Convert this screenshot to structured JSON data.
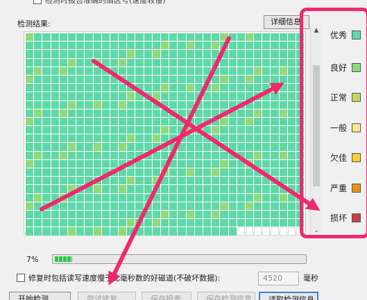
{
  "options": {
    "report_check_label": "检测时报告准确的扇区号(速度较慢)",
    "repair_check_label": "修复时包括读写速度慢于比毫秒数的好磁道(不破坏数据):",
    "threshold_value": "4520",
    "threshold_unit": "毫秒"
  },
  "results": {
    "label": "检测结果:",
    "detail_button": "详细信息",
    "grid": {
      "columns": 33,
      "rows": 24,
      "empty_tail": 8,
      "status_key": [
        "优秀",
        "良好",
        "空白"
      ]
    }
  },
  "legend": [
    {
      "label": "优秀",
      "color": "#5fd8a8"
    },
    {
      "label": "良好",
      "color": "#8fd97a"
    },
    {
      "label": "正常",
      "color": "#c2d95a"
    },
    {
      "label": "一般",
      "color": "#ffe38f"
    },
    {
      "label": "欠佳",
      "color": "#ffcc33"
    },
    {
      "label": "严重",
      "color": "#e8931a"
    },
    {
      "label": "损坏",
      "color": "#c84040"
    }
  ],
  "progress": {
    "percent_label": "7%",
    "fraction": 0.07
  },
  "buttons": [
    {
      "label": "开始检测",
      "enabled": true
    },
    {
      "label": "尝试修复",
      "enabled": false
    },
    {
      "label": "保存报表",
      "enabled": false
    },
    {
      "label": "保存检测信息",
      "enabled": false
    },
    {
      "label": "读取检测信息",
      "enabled": true
    }
  ],
  "annotation_color": "#f0286e"
}
